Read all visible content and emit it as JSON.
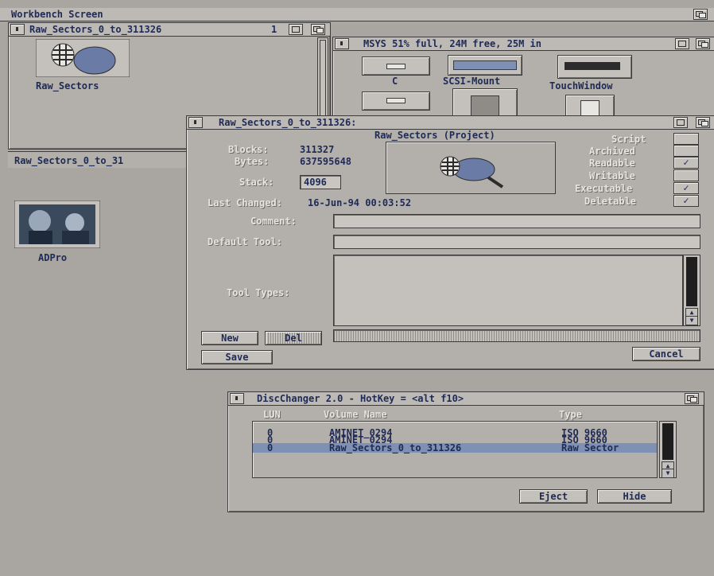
{
  "screen": {
    "title": "Workbench Screen"
  },
  "rawwin": {
    "title": "Raw_Sectors_0_to_311326",
    "status": "1",
    "icon_label": "Raw_Sectors"
  },
  "msys": {
    "title": "MSYS  51% full, 24M free, 25M in",
    "icons": [
      "C",
      "SCSI-Mount",
      "TouchWindow"
    ]
  },
  "rawlist": {
    "title": "Raw_Sectors_0_to_31"
  },
  "adpro": {
    "label": "ADPro"
  },
  "info": {
    "title": "Raw_Sectors_0_to_311326:",
    "project": "Raw_Sectors (Project)",
    "blocks_label": "Blocks:",
    "blocks": "311327",
    "bytes_label": "Bytes:",
    "bytes": "637595648",
    "stack_label": "Stack:",
    "stack": "4096",
    "changed_label": "Last Changed:",
    "changed": "16-Jun-94 00:03:52",
    "comment_label": "Comment:",
    "tool_label": "Default Tool:",
    "types_label": "Tool Types:",
    "flags": [
      {
        "label": "Script",
        "checked": false
      },
      {
        "label": "Archived",
        "checked": false
      },
      {
        "label": "Readable",
        "checked": true
      },
      {
        "label": "Writable",
        "checked": false
      },
      {
        "label": "Executable",
        "checked": true
      },
      {
        "label": "Deletable",
        "checked": true
      }
    ],
    "check_glyph": "✓",
    "new": "New",
    "del": "Del",
    "save": "Save",
    "cancel": "Cancel"
  },
  "disc": {
    "title": "DiscChanger 2.0  -  HotKey = <alt f10>",
    "cols": [
      "LUN",
      "Volume Name",
      "Type"
    ],
    "rows": [
      {
        "lun": "0",
        "name": "AMINET_0294",
        "type": "ISO 9660"
      },
      {
        "lun": "0",
        "name": "AMINET_0294",
        "type": "ISO 9660"
      },
      {
        "lun": "0",
        "name": "Raw_Sectors_0_to_311326",
        "type": "Raw Sector"
      }
    ],
    "eject": "Eject",
    "hide": "Hide"
  },
  "colors": {
    "desktop": "#a9a6a1",
    "text": "#1f2a55",
    "highlight": "#7e91b4"
  }
}
